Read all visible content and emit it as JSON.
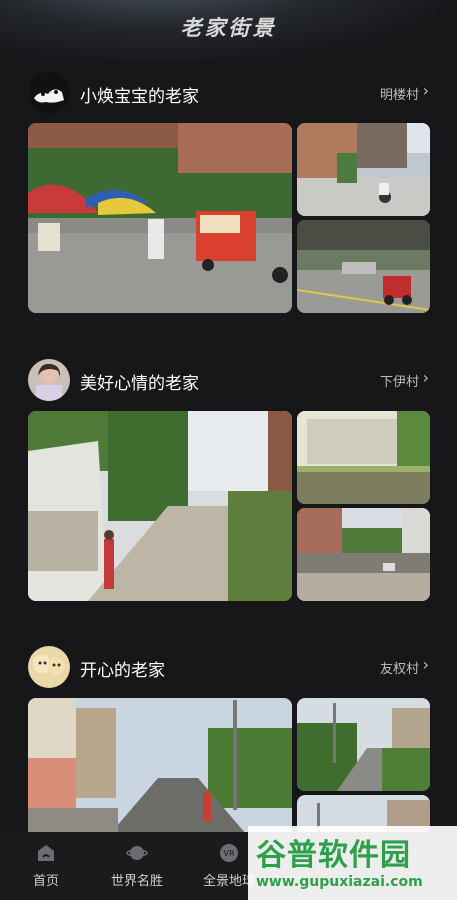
{
  "header": {
    "title": "老家街景"
  },
  "cards": [
    {
      "owner": "小焕宝宝的老家",
      "village": "明楼村"
    },
    {
      "owner": "美好心情的老家",
      "village": "下伊村"
    },
    {
      "owner": "开心的老家",
      "village": "友权村"
    }
  ],
  "tabbar": {
    "items": [
      {
        "label": "首页",
        "icon": "home-icon"
      },
      {
        "label": "世界名胜",
        "icon": "planet-icon"
      },
      {
        "label": "全景地球",
        "icon": "vr-icon"
      }
    ]
  },
  "watermark": {
    "text": "谷普软件园",
    "url": "www.gupuxiazai.com"
  },
  "colors": {
    "background": "#17171a",
    "watermark_green": "#2da14a"
  }
}
